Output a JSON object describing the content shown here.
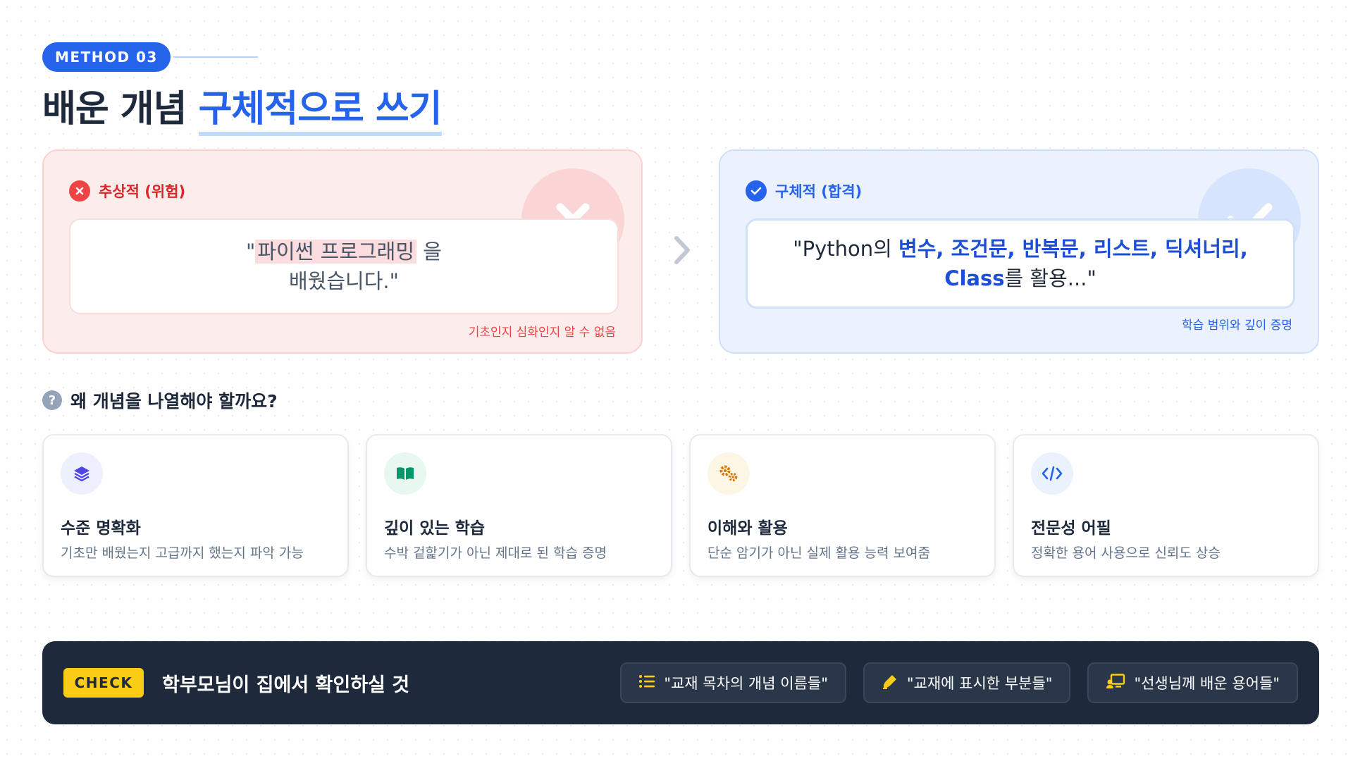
{
  "header": {
    "badge": "METHOD 03",
    "title_plain": "배운 개념",
    "title_highlight": "구체적으로 쓰기"
  },
  "bad": {
    "label": "추상적 (위험)",
    "quote_open": "\"",
    "quote_mark": "파이썬 프로그래밍",
    "quote_after": " 을",
    "quote_line2": "배웠습니다.\"",
    "note": "기초인지 심화인지 알 수 없음"
  },
  "good": {
    "label": "구체적 (합격)",
    "quote_pre": "\"Python의 ",
    "quote_keywords": "변수, 조건문, 반복문, 리스트, 딕셔너리, Class",
    "quote_post": "를 활용...\"",
    "note": "학습 범위와 깊이 증명"
  },
  "why": {
    "icon": "question-icon",
    "title": "왜 개념을 나열해야 할까요?",
    "items": [
      {
        "icon": "layers-icon",
        "title": "수준 명확화",
        "desc": "기초만 배웠는지 고급까지 했는지 파악 가능",
        "bg": "#eef0fd",
        "color": "#4f46e5"
      },
      {
        "icon": "book-icon",
        "title": "깊이 있는 학습",
        "desc": "수박 겉핥기가 아닌 제대로 된 학습 증명",
        "bg": "#e8f8f0",
        "color": "#059669"
      },
      {
        "icon": "gears-icon",
        "title": "이해와 활용",
        "desc": "단순 암기가 아닌 실제 활용 능력 보여줌",
        "bg": "#fef6e4",
        "color": "#d97706"
      },
      {
        "icon": "code-icon",
        "title": "전문성 어필",
        "desc": "정확한 용어 사용으로 신뢰도 상승",
        "bg": "#eaf3fd",
        "color": "#2563eb"
      }
    ]
  },
  "check": {
    "tag": "CHECK",
    "text": "학부모님이 집에서 확인하실 것",
    "chips": [
      {
        "icon": "list-icon",
        "label": "\"교재 목차의 개념 이름들\""
      },
      {
        "icon": "highlighter-icon",
        "label": "\"교재에 표시한 부분들\""
      },
      {
        "icon": "teacher-icon",
        "label": "\"선생님께 배운 용어들\""
      }
    ]
  },
  "colors": {
    "accent": "#2563eb",
    "danger": "#ef4444",
    "dark": "#1e293b",
    "check_yellow": "#facc15"
  }
}
